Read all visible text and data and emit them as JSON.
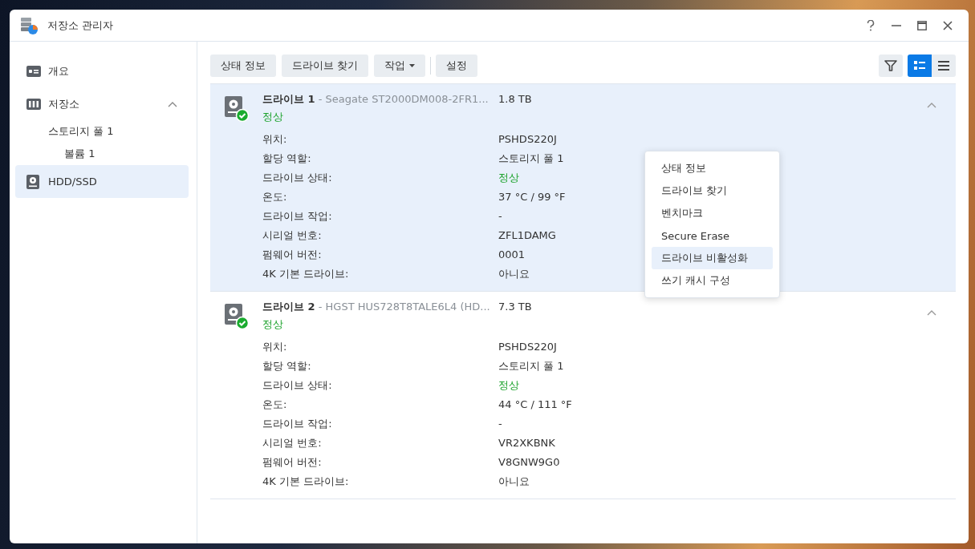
{
  "window": {
    "title": "저장소 관리자"
  },
  "sidebar": {
    "items": [
      {
        "label": "개요",
        "selected": false
      },
      {
        "label": "저장소",
        "selected": false,
        "expanded": true,
        "children": [
          {
            "label": "스토리지 풀 1",
            "selected": false,
            "children": [
              {
                "label": "볼륨 1",
                "selected": false
              }
            ]
          }
        ]
      },
      {
        "label": "HDD/SSD",
        "selected": true
      }
    ]
  },
  "toolbar": {
    "buttons": [
      {
        "label": "상태 정보",
        "dropdown": false
      },
      {
        "label": "드라이브 찾기",
        "dropdown": false
      },
      {
        "label": "작업",
        "dropdown": true
      },
      {
        "label": "설정",
        "dropdown": false
      }
    ],
    "views": [
      {
        "kind": "detail",
        "selected": true
      },
      {
        "kind": "list",
        "selected": false
      }
    ]
  },
  "drives": [
    {
      "title": "**드라이브 1** - Seagate ST2000DM008-2FR1...",
      "size": "1.8 TB",
      "status": "정상",
      "selected": true,
      "expanded": true,
      "properties": [
        {
          "label": "위치:",
          "value": "PSHDS220J",
          "kind": "plain"
        },
        {
          "label": "할당 역할:",
          "value": "스토리지 풀 1",
          "kind": "plain"
        },
        {
          "label": "드라이브 상태:",
          "value": "정상",
          "kind": "status"
        },
        {
          "label": "온도:",
          "value": "37 °C / 99 °F",
          "kind": "plain"
        },
        {
          "label": "드라이브 작업:",
          "value": "-",
          "kind": "plain"
        },
        {
          "label": "시리얼 번호:",
          "value": "ZFL1DAMG",
          "kind": "plain"
        },
        {
          "label": "펌웨어 버전:",
          "value": "0001",
          "kind": "plain"
        },
        {
          "label": "4K 기본 드라이브:",
          "value": "아니요",
          "kind": "plain"
        }
      ]
    },
    {
      "title": "**드라이브 2** - HGST HUS728T8TALE6L4 (HD...",
      "size": "7.3 TB",
      "status": "정상",
      "selected": false,
      "expanded": true,
      "properties": [
        {
          "label": "위치:",
          "value": "PSHDS220J",
          "kind": "plain"
        },
        {
          "label": "할당 역할:",
          "value": "스토리지 풀 1",
          "kind": "plain"
        },
        {
          "label": "드라이브 상태:",
          "value": "정상",
          "kind": "status"
        },
        {
          "label": "온도:",
          "value": "44 °C / 111 °F",
          "kind": "plain"
        },
        {
          "label": "드라이브 작업:",
          "value": "-",
          "kind": "plain"
        },
        {
          "label": "시리얼 번호:",
          "value": "VR2XKBNK",
          "kind": "plain"
        },
        {
          "label": "펌웨어 버전:",
          "value": "V8GNW9G0",
          "kind": "plain"
        },
        {
          "label": "4K 기본 드라이브:",
          "value": "아니요",
          "kind": "plain"
        }
      ]
    }
  ],
  "context_menu": {
    "items": [
      {
        "label": "상태 정보",
        "selected": false
      },
      {
        "label": "드라이브 찾기",
        "selected": false
      },
      {
        "label": "벤치마크",
        "selected": false
      },
      {
        "label": "Secure Erase",
        "selected": false
      },
      {
        "label": "드라이브 비활성화",
        "selected": true
      },
      {
        "label": "쓰기 캐시 구성",
        "selected": false
      }
    ]
  }
}
